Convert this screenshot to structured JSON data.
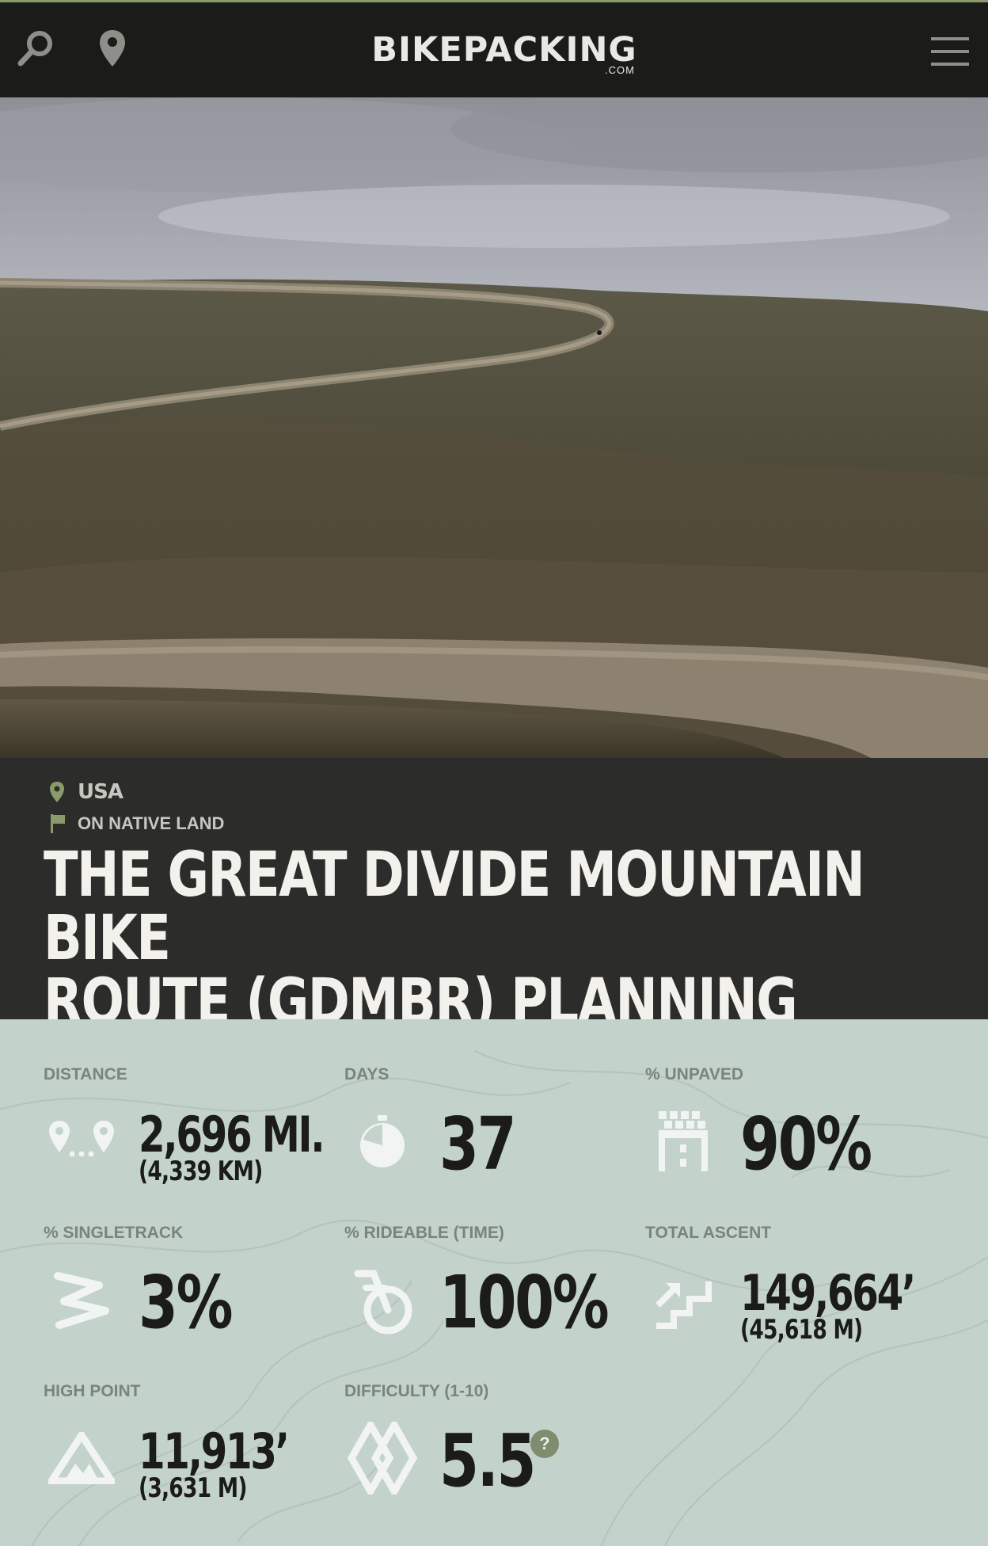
{
  "header": {
    "logo_text": "BIKEPACKING",
    "logo_sub": ".COM",
    "search_icon": "search-icon",
    "location_icon": "map-pin-icon",
    "menu_icon": "hamburger-menu-icon"
  },
  "hero": {
    "image_alt": "Gravel road winding across sagebrush hills under an overcast sky"
  },
  "route": {
    "country": "USA",
    "land_note": "ON NATIVE LAND",
    "title_line1": "THE GREAT DIVIDE MOUNTAIN BIKE",
    "title_line2": "ROUTE (GDMBR) PLANNING GUIDE"
  },
  "stats": {
    "distance": {
      "label": "DISTANCE",
      "value": "2,696 MI.",
      "sub": "(4,339 KM)",
      "icon": "distance-pins-icon"
    },
    "days": {
      "label": "DAYS",
      "value": "37",
      "icon": "stopwatch-icon"
    },
    "unpaved": {
      "label": "% UNPAVED",
      "value": "90%",
      "icon": "unpaved-road-icon"
    },
    "singletrack": {
      "label": "% SINGLETRACK",
      "value": "3%",
      "icon": "singletrack-icon"
    },
    "rideable": {
      "label": "% RIDEABLE (TIME)",
      "value": "100%",
      "icon": "bicycle-wheel-icon"
    },
    "ascent": {
      "label": "TOTAL ASCENT",
      "value": "149,664’",
      "sub": "(45,618 M)",
      "icon": "stairs-up-icon"
    },
    "high_point": {
      "label": "HIGH POINT",
      "value": "11,913’",
      "sub": "(3,631 M)",
      "icon": "mountain-icon"
    },
    "difficulty": {
      "label": "DIFFICULTY (1-10)",
      "value": "5.5",
      "help": "?",
      "icon": "difficulty-diamond-icon"
    }
  },
  "colors": {
    "header_bg": "#1b1c19",
    "title_band_bg": "#2c2c2b",
    "stats_bg": "#c3d2cb",
    "accent_olive": "#7f8c6e",
    "label_gray": "#7a837e",
    "value_dark": "#1b1c19"
  }
}
